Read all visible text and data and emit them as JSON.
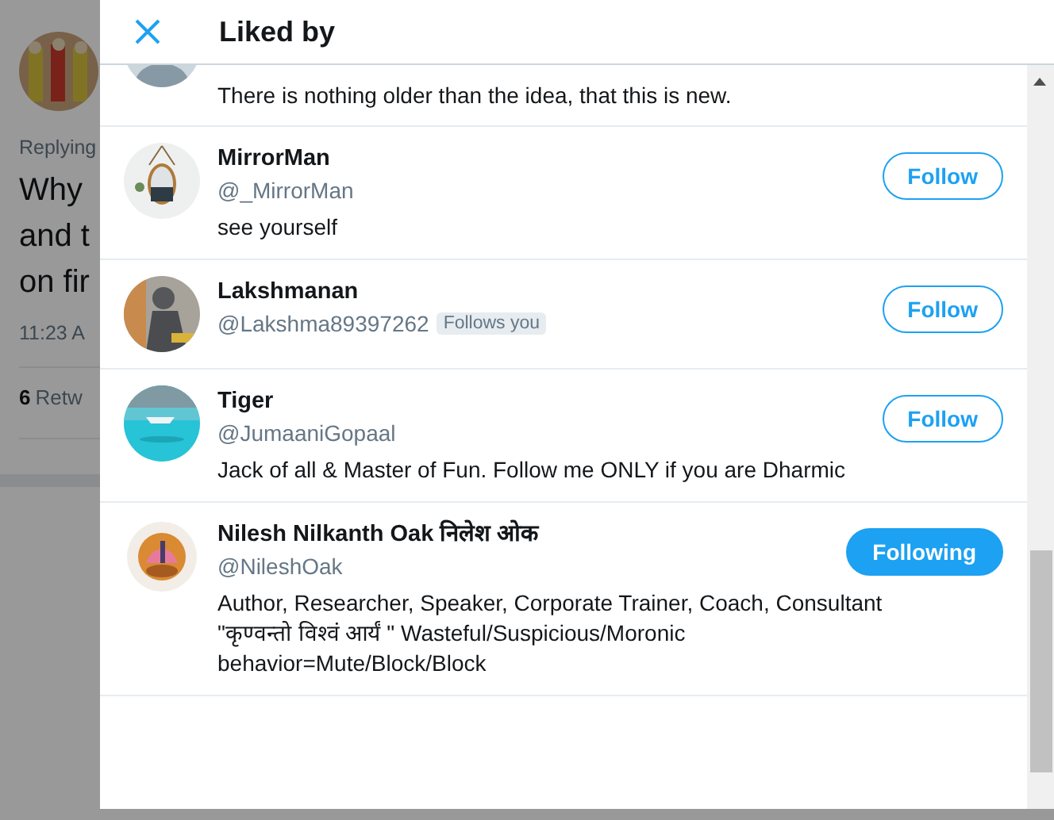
{
  "background": {
    "reply_label": "Replying",
    "tweet_lines": [
      "Why",
      "and t",
      "on fir"
    ],
    "time": "11:23 A",
    "retweet_count": "6",
    "retweet_label": "Retw"
  },
  "modal": {
    "title": "Liked by"
  },
  "users": [
    {
      "bio": "There is nothing older than the idea, that this is new."
    },
    {
      "name": "MirrorMan",
      "handle": "@_MirrorMan",
      "bio": "see yourself",
      "button": "Follow",
      "following": false
    },
    {
      "name": "Lakshmanan",
      "handle": "@Lakshma89397262",
      "badge": "Follows you",
      "button": "Follow",
      "following": false
    },
    {
      "name": "Tiger",
      "handle": "@JumaaniGopaal",
      "bio": "Jack of all & Master of Fun. Follow me ONLY if you are Dharmic",
      "button": "Follow",
      "following": false
    },
    {
      "name": "Nilesh Nilkanth Oak निलेश ओक",
      "handle": "@NileshOak",
      "bio": "Author, Researcher, Speaker, Corporate Trainer, Coach, Consultant\n\"कृण्वन्तो विश्वं आर्यं \" Wasteful/Suspicious/Moronic\nbehavior=Mute/Block/Block",
      "button": "Following",
      "following": true
    }
  ]
}
